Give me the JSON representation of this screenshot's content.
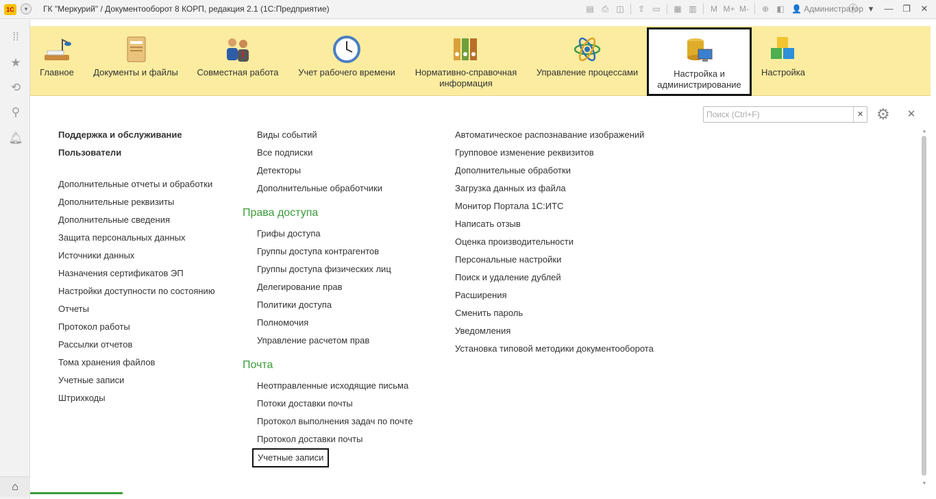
{
  "window": {
    "title": "ГК \"Меркурий\" / Документооборот 8 КОРП, редакция 2.1  (1С:Предприятие)",
    "logo": "1C",
    "user": "Администратор",
    "toolbar_icons": [
      "save-icon",
      "print-icon",
      "print-preview-icon",
      "upload-icon",
      "scanner-icon",
      "calendar-icon",
      "table-icon",
      "M",
      "M+",
      "M-",
      "zoom-icon",
      "panel-icon"
    ]
  },
  "sections": [
    {
      "label": "Главное",
      "icon": "desk-lamp-icon"
    },
    {
      "label": "Документы и файлы",
      "icon": "document-folder-icon"
    },
    {
      "label": "Совместная работа",
      "icon": "people-icon"
    },
    {
      "label": "Учет рабочего времени",
      "icon": "clock-icon"
    },
    {
      "label": "Нормативно-справочная\nинформация",
      "icon": "binders-icon"
    },
    {
      "label": "Управление процессами",
      "icon": "atom-icon"
    },
    {
      "label": "Настройка и\nадминистрирование",
      "icon": "database-monitor-icon",
      "active": true
    },
    {
      "label": "Настройка",
      "icon": "cubes-icon"
    }
  ],
  "search": {
    "placeholder": "Поиск (Ctrl+F)",
    "value": ""
  },
  "col1": {
    "bold_items": [
      "Поддержка и обслуживание",
      "Пользователи"
    ],
    "items": [
      "Дополнительные отчеты и обработки",
      "Дополнительные реквизиты",
      "Дополнительные сведения",
      "Защита персональных данных",
      "Источники данных",
      "Назначения сертификатов ЭП",
      "Настройки доступности по состоянию",
      "Отчеты",
      "Протокол работы",
      "Рассылки отчетов",
      "Тома хранения файлов",
      "Учетные записи",
      "Штрихкоды"
    ]
  },
  "col2": {
    "top_items": [
      "Виды событий",
      "Все подписки",
      "Детекторы",
      "Дополнительные обработчики"
    ],
    "groups": [
      {
        "title": "Права доступа",
        "items": [
          "Грифы доступа",
          "Группы доступа контрагентов",
          "Группы доступа физических лиц",
          "Делегирование прав",
          "Политики доступа",
          "Полномочия",
          "Управление расчетом прав"
        ]
      },
      {
        "title": "Почта",
        "items": [
          "Неотправленные исходящие письма",
          "Потоки доставки почты",
          "Протокол выполнения задач по почте",
          "Протокол доставки почты",
          "Учетные записи"
        ]
      }
    ]
  },
  "col3": {
    "items": [
      "Автоматическое распознавание изображений",
      "Групповое изменение реквизитов",
      "Дополнительные обработки",
      "Загрузка данных из файла",
      "Монитор Портала 1С:ИТС",
      "Написать отзыв",
      "Оценка производительности",
      "Персональные настройки",
      "Поиск и удаление дублей",
      "Расширения",
      "Сменить пароль",
      "Уведомления",
      "Установка типовой методики документооборота"
    ]
  },
  "colors": {
    "accent_green": "#3b9b3b",
    "sections_bg": "#fbeca0",
    "highlight_border": "#111111"
  }
}
